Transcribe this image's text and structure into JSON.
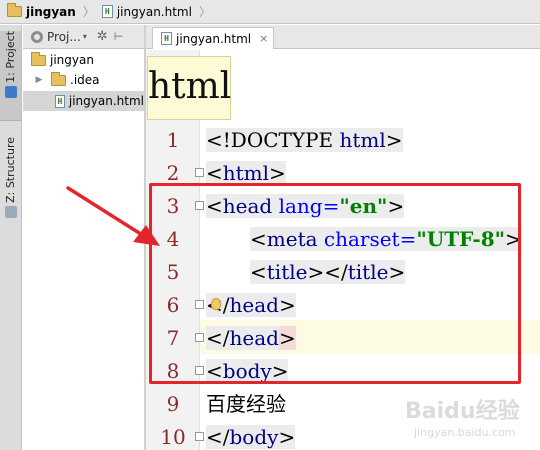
{
  "breadcrumb": {
    "project": "jingyan",
    "file": "jingyan.html",
    "separator": "〉"
  },
  "tool_stripe": {
    "project_tab": "1: Project",
    "structure_tab": "Z: Structure"
  },
  "project_panel": {
    "title": "Proj...",
    "tree": [
      {
        "label": "jingyan",
        "kind": "folder"
      },
      {
        "label": ".idea",
        "kind": "folder"
      },
      {
        "label": "jingyan.html",
        "kind": "html",
        "selected": true
      }
    ]
  },
  "editor": {
    "tab_label": "jingyan.html",
    "tab_close": "×",
    "zoom_tooltip": "html",
    "line_numbers": [
      "1",
      "2",
      "3",
      "4",
      "5",
      "6",
      "7",
      "8",
      "9",
      "10"
    ],
    "lines": {
      "l1": {
        "open": "<!DOCTYPE ",
        "name": "html",
        "close": ">"
      },
      "l2": {
        "open": "<",
        "name": "html",
        "close": ">"
      },
      "l3": {
        "open": "<",
        "name": "head",
        "attr": " lang=",
        "val": "\"en\"",
        "close": ">"
      },
      "l4": {
        "open": "<",
        "name": "meta",
        "attr": " charset=",
        "val": "\"UTF-8\"",
        "close": ">"
      },
      "l5": {
        "open": "<",
        "name": "title",
        "mid": "></",
        "name2": "title",
        "close": ">"
      },
      "l6": {
        "open": "</",
        "name": "head",
        "close": ">"
      },
      "l7": {
        "open": "</",
        "name": "head",
        "close": ">"
      },
      "l8": {
        "open": "<",
        "name": "body",
        "close": ">"
      },
      "l9": {
        "text": "百度经验"
      },
      "l10": {
        "open": "</",
        "name": "body",
        "close": ">"
      }
    }
  },
  "watermark": {
    "main": "Baidu经验",
    "sub": "jingyan.baidu.com"
  },
  "colors": {
    "annotation": "#e3262c",
    "tag_name": "#000080",
    "attr_name": "#0000ff",
    "string": "#008000",
    "line_number": "#8a2a2a"
  }
}
